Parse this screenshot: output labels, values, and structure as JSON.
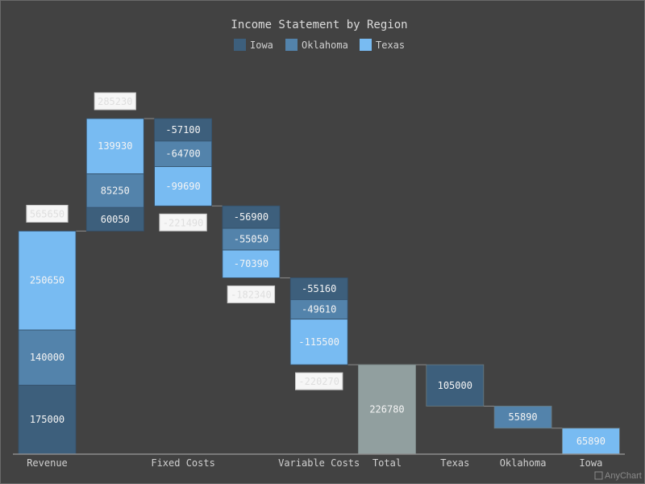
{
  "chart_data": {
    "type": "bar",
    "subtype": "stacked-waterfall",
    "title": "Income Statement by Region",
    "legend": {
      "placement": "top-center",
      "items": [
        {
          "name": "Iowa",
          "color": "#3d5f7c"
        },
        {
          "name": "Oklahoma",
          "color": "#5383ab"
        },
        {
          "name": "Texas",
          "color": "#78bbf2"
        }
      ]
    },
    "categories": [
      "Revenue",
      "",
      "Fixed Costs",
      "",
      "Variable Costs",
      "Total",
      "Texas",
      "Oklahoma",
      "Iowa"
    ],
    "series": [
      {
        "name": "Iowa",
        "values": [
          175000,
          60050,
          -57100,
          -56900,
          -55160,
          null,
          105000,
          null,
          null
        ]
      },
      {
        "name": "Oklahoma",
        "values": [
          140000,
          85250,
          -64700,
          -55050,
          -49610,
          null,
          null,
          55890,
          null
        ]
      },
      {
        "name": "Texas",
        "values": [
          250650,
          139930,
          -99690,
          -70390,
          -115500,
          null,
          null,
          null,
          65890
        ]
      }
    ],
    "totals": [
      565650,
      285230,
      -221490,
      -182340,
      -220270,
      226780,
      105000,
      55890,
      65890
    ],
    "total_labels": [
      "565650",
      "285230",
      "-221490",
      "-182340",
      "-220270"
    ],
    "total_bar": {
      "category": "Total",
      "value": 226780,
      "color": "#919f9f"
    },
    "xlabel": "",
    "ylabel": "",
    "ylim": [
      0,
      850880
    ],
    "grid": false,
    "credit": "AnyChart"
  }
}
